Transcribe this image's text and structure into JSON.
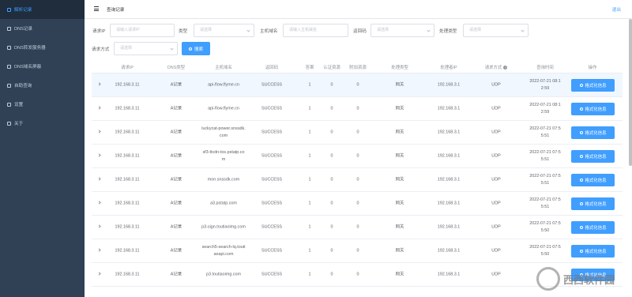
{
  "sidebar": {
    "items": [
      {
        "label": "解析记录",
        "active": true
      },
      {
        "label": "DNS记录",
        "active": false
      },
      {
        "label": "DNS转发服务器",
        "active": false
      },
      {
        "label": "DNS域名屏蔽",
        "active": false
      },
      {
        "label": "自助查询",
        "active": false
      },
      {
        "label": "设置",
        "active": false
      },
      {
        "label": "关于",
        "active": false
      }
    ]
  },
  "header": {
    "breadcrumb": "查询记录",
    "logout": "退出"
  },
  "filters": {
    "request_ip_label": "请求IP",
    "request_ip_placeholder": "请输入请求IP",
    "type_label": "类型",
    "type_placeholder": "请选择",
    "host_label": "主机域名",
    "host_placeholder": "请输入主机域名",
    "return_code_label": "返回码",
    "return_code_placeholder": "请选择",
    "process_type_label": "处理类型",
    "process_type_placeholder": "请选择",
    "request_method_label": "请求方式",
    "request_method_placeholder": "请选择",
    "search_label": "搜索"
  },
  "table": {
    "headers": [
      "请求IP",
      "DNS类型",
      "主机域名",
      "返回码",
      "答案",
      "认证资源",
      "附加资源",
      "处理类型",
      "处理者IP",
      "请求方式",
      "查询时间",
      "操作"
    ],
    "op_label": "格式化信息",
    "rows": [
      {
        "ip": "192.168.3.11",
        "dns_type": "A记录",
        "host": "api-flow.flyme.cn",
        "code": "SUCCESS",
        "ans": "1",
        "auth": "0",
        "extra": "0",
        "ptype": "网关",
        "handler": "192.168.3.1",
        "method": "UDP",
        "time": "2022-07-21 08:12:59",
        "highlight": true
      },
      {
        "ip": "192.168.3.11",
        "dns_type": "A记录",
        "host": "api-flow.flyme.cn",
        "code": "SUCCESS",
        "ans": "1",
        "auth": "0",
        "extra": "0",
        "ptype": "网关",
        "handler": "192.168.3.1",
        "method": "UDP",
        "time": "2022-07-21 08:12:59",
        "highlight": false
      },
      {
        "ip": "192.168.3.11",
        "dns_type": "A记录",
        "host": "luckycat-power.snssdk.com",
        "code": "SUCCESS",
        "ans": "1",
        "auth": "0",
        "extra": "0",
        "ptype": "网关",
        "handler": "192.168.3.1",
        "method": "UDP",
        "time": "2022-07-21 07:55:51",
        "highlight": false
      },
      {
        "ip": "192.168.3.11",
        "dns_type": "A记录",
        "host": "sf3-ttcdn-tos.pstatp.com",
        "code": "SUCCESS",
        "ans": "1",
        "auth": "0",
        "extra": "0",
        "ptype": "网关",
        "handler": "192.168.3.1",
        "method": "UDP",
        "time": "2022-07-21 07:55:51",
        "highlight": false
      },
      {
        "ip": "192.168.3.11",
        "dns_type": "A记录",
        "host": "mon.snssdk.com",
        "code": "SUCCESS",
        "ans": "1",
        "auth": "0",
        "extra": "0",
        "ptype": "网关",
        "handler": "192.168.3.1",
        "method": "UDP",
        "time": "2022-07-21 07:55:51",
        "highlight": false
      },
      {
        "ip": "192.168.3.11",
        "dns_type": "A记录",
        "host": "a3.pstatp.com",
        "code": "SUCCESS",
        "ans": "1",
        "auth": "0",
        "extra": "0",
        "ptype": "网关",
        "handler": "192.168.3.1",
        "method": "UDP",
        "time": "2022-07-21 07:55:51",
        "highlight": false
      },
      {
        "ip": "192.168.3.11",
        "dns_type": "A记录",
        "host": "p3-sign.toutiaoimg.com",
        "code": "SUCCESS",
        "ans": "1",
        "auth": "0",
        "extra": "0",
        "ptype": "网关",
        "handler": "192.168.3.1",
        "method": "UDP",
        "time": "2022-07-21 07:55:50",
        "highlight": false
      },
      {
        "ip": "192.168.3.11",
        "dns_type": "A记录",
        "host": "search5-search-lq.toutiaoapi.com",
        "code": "SUCCESS",
        "ans": "1",
        "auth": "0",
        "extra": "0",
        "ptype": "网关",
        "handler": "192.168.3.1",
        "method": "UDP",
        "time": "2022-07-21 07:55:50",
        "highlight": false
      },
      {
        "ip": "192.168.3.11",
        "dns_type": "A记录",
        "host": "p3.toutiaoimg.com",
        "code": "SUCCESS",
        "ans": "1",
        "auth": "0",
        "extra": "0",
        "ptype": "网关",
        "handler": "192.168.3.1",
        "method": "UDP",
        "time": "",
        "highlight": false
      }
    ]
  },
  "watermark": "西西软件园",
  "colors": {
    "sidebar_bg": "#304156",
    "active_bg": "#1f2d3d",
    "accent": "#409eff",
    "row_highlight": "#f0f7ff"
  }
}
